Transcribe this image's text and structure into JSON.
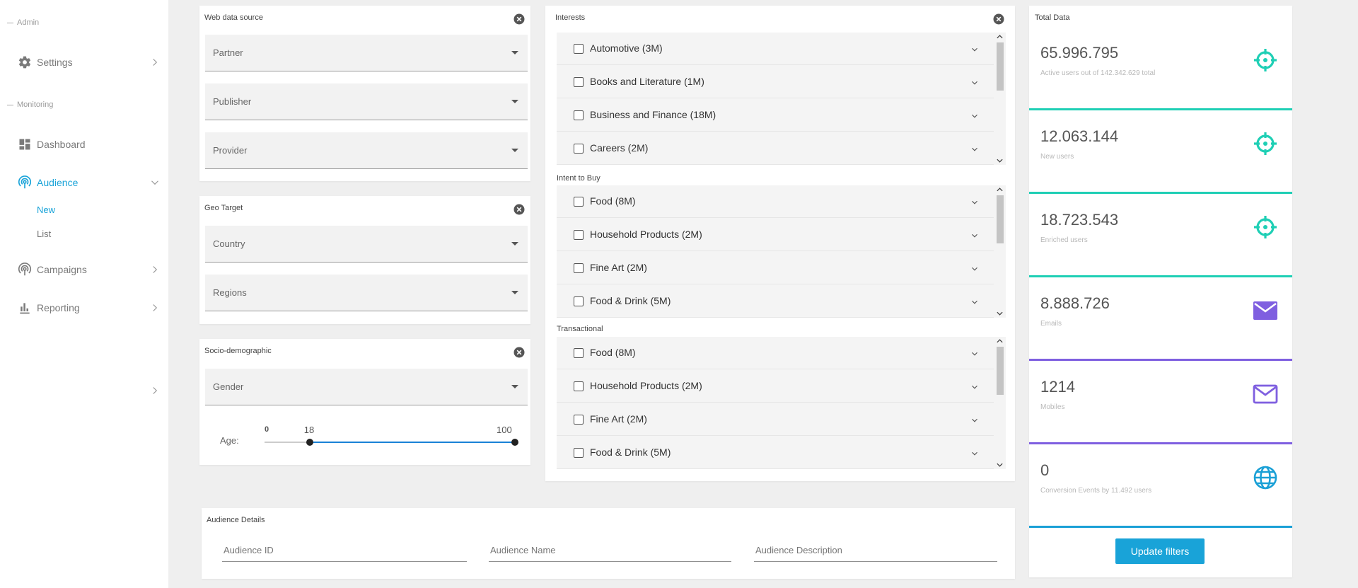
{
  "sidebar": {
    "admin_label": "Admin",
    "monitoring_label": "Monitoring",
    "settings": "Settings",
    "dashboard": "Dashboard",
    "audience": "Audience",
    "audience_new": "New",
    "audience_list": "List",
    "campaigns": "Campaigns",
    "reporting": "Reporting"
  },
  "web_source": {
    "title": "Web data source",
    "partner": "Partner",
    "publisher": "Publisher",
    "provider": "Provider"
  },
  "geo": {
    "title": "Geo Target",
    "country": "Country",
    "regions": "Regions"
  },
  "socio": {
    "title": "Socio-demographic",
    "gender": "Gender",
    "age_label": "Age:",
    "age_min": "0",
    "age_low": "18",
    "age_high": "100",
    "age_range": {
      "min": 0,
      "max": 100,
      "low": 18,
      "high": 100
    }
  },
  "interests": {
    "title": "Interests",
    "items": [
      "Automotive (3M)",
      "Books and Literature (1M)",
      "Business and Finance (18M)",
      "Careers (2M)"
    ]
  },
  "intent": {
    "title": "Intent to Buy",
    "items": [
      "Food (8M)",
      "Household Products (2M)",
      "Fine Art (2M)",
      "Food & Drink (5M)"
    ]
  },
  "transactional": {
    "title": "Transactional",
    "items": [
      "Food (8M)",
      "Household Products (2M)",
      "Fine Art (2M)",
      "Food & Drink (5M)"
    ]
  },
  "total": {
    "title": "Total Data",
    "stats": [
      {
        "value": "65.996.795",
        "desc": "Active users out of 142.342.629 total",
        "icon": "target-icon",
        "color": "#1fcfb5"
      },
      {
        "value": "12.063.144",
        "desc": "New users",
        "icon": "target-icon",
        "color": "#1fcfb5"
      },
      {
        "value": "18.723.543",
        "desc": "Enriched users",
        "icon": "target-icon",
        "color": "#1fcfb5"
      },
      {
        "value": "8.888.726",
        "desc": "Emails",
        "icon": "mail-filled-icon",
        "color": "#7f5fe0"
      },
      {
        "value": "1214",
        "desc": "Mobiles",
        "icon": "mail-outline-icon",
        "color": "#7f5fe0"
      },
      {
        "value": "0",
        "desc": "Conversion Events by 11.492 users",
        "icon": "globe-icon",
        "color": "#1aa0d6"
      }
    ],
    "update_button": "Update filters"
  },
  "details": {
    "title": "Audience Details",
    "id_placeholder": "Audience ID",
    "name_placeholder": "Audience Name",
    "desc_placeholder": "Audience Description"
  },
  "colors": {
    "accent": "#19a3d8",
    "teal": "#1fcfb5",
    "purple": "#7f5fe0",
    "slider": "#1a82d6"
  }
}
